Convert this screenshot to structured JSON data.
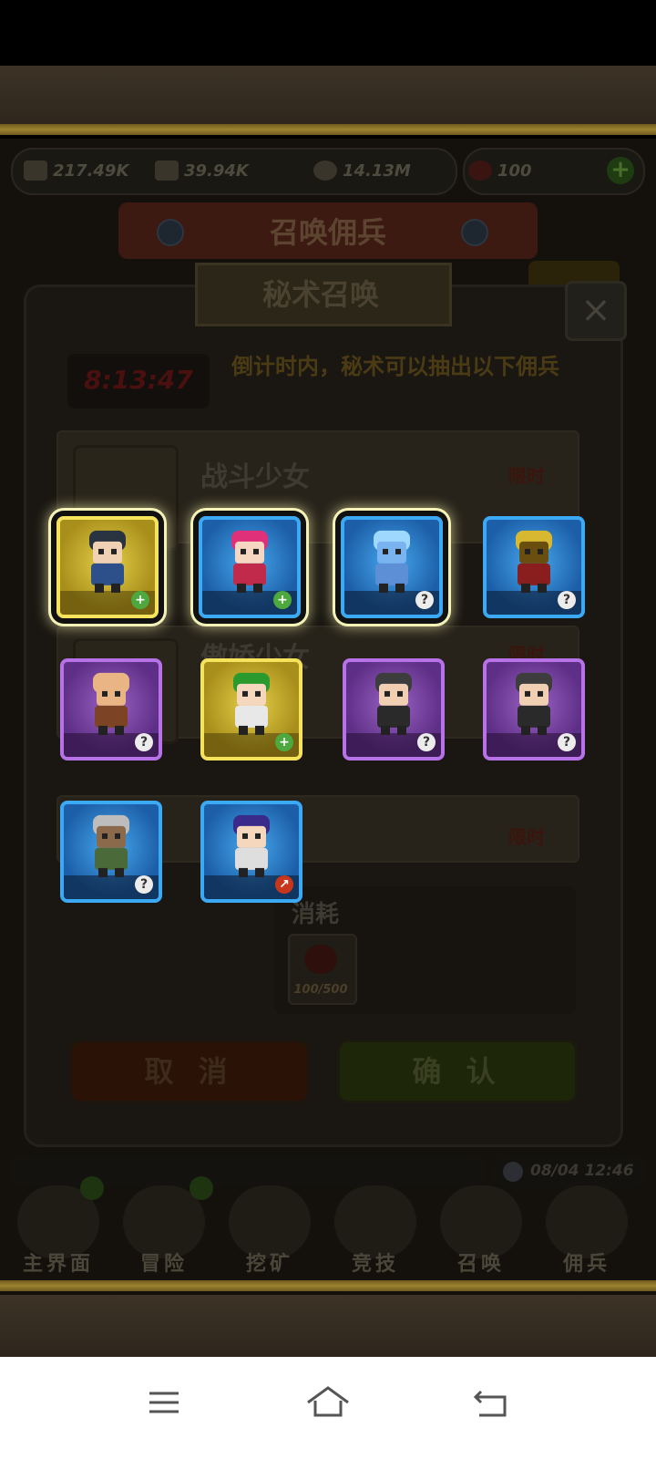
{
  "resources": {
    "attack": "217.49K",
    "exp": "39.94K",
    "gold": "14.13M",
    "meat": "100"
  },
  "banner": {
    "title": "召唤佣兵"
  },
  "dialog": {
    "title": "秘术召唤",
    "close_label": "×",
    "timer": "8:13:47",
    "notice": "倒计时内，秘术可以抽出以下佣兵",
    "cards": [
      {
        "name": "战斗少女",
        "tag": "限时"
      },
      {
        "name": "傲娇少女",
        "tag": "限时"
      },
      {
        "name": "",
        "tag": "限时"
      }
    ],
    "cost_label": "消耗",
    "cost_count": "100/500",
    "cancel_label": "取 消",
    "confirm_label": "确 认"
  },
  "heroes": [
    {
      "name": "dark-haired-swordsman",
      "rarity": "gold",
      "selected": true,
      "badge": "plus"
    },
    {
      "name": "pink-haired-girl",
      "rarity": "blue",
      "selected": true,
      "badge": "plus"
    },
    {
      "name": "ice-spirit",
      "rarity": "blue",
      "selected": true,
      "badge": "q"
    },
    {
      "name": "golden-armored-knight",
      "rarity": "blue",
      "selected": false,
      "badge": "q"
    },
    {
      "name": "bald-monk",
      "rarity": "purple",
      "selected": false,
      "badge": "q"
    },
    {
      "name": "green-haired-girl",
      "rarity": "gold",
      "selected": false,
      "badge": "plus"
    },
    {
      "name": "gray-haired-man-1",
      "rarity": "purple",
      "selected": false,
      "badge": "q"
    },
    {
      "name": "gray-haired-man-2",
      "rarity": "purple",
      "selected": false,
      "badge": "q"
    },
    {
      "name": "helmeted-dwarf",
      "rarity": "blue",
      "selected": false,
      "badge": "q"
    },
    {
      "name": "purple-haired-girl",
      "rarity": "blue",
      "selected": false,
      "badge": "link"
    }
  ],
  "status": {
    "datetime": "08/04 12:46"
  },
  "nav": [
    {
      "label": "主界面",
      "icon": "map-icon"
    },
    {
      "label": "冒险",
      "icon": "adventure-icon"
    },
    {
      "label": "挖矿",
      "icon": "pickaxe-icon"
    },
    {
      "label": "竞技",
      "icon": "swords-icon"
    },
    {
      "label": "召唤",
      "icon": "scroll-icon"
    },
    {
      "label": "佣兵",
      "icon": "mercenary-icon"
    }
  ],
  "android_nav": [
    "menu-icon",
    "home-icon",
    "back-icon"
  ]
}
